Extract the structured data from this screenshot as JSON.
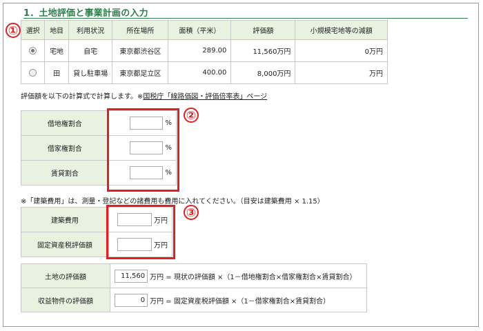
{
  "section_title": "1．土地評価と事業計画の入力",
  "markers": [
    "①",
    "②",
    "③"
  ],
  "land_table": {
    "headers": [
      "選択",
      "地目",
      "利用状況",
      "所在場所",
      "面積（平米）",
      "評価額",
      "小規模宅地等の減額"
    ],
    "rows": [
      {
        "selected": true,
        "type": "宅地",
        "usage": "自宅",
        "location": "東京都渋谷区",
        "area": "289.00",
        "value": "11,560万円",
        "reduction": "0万円"
      },
      {
        "selected": false,
        "type": "田",
        "usage": "貸し駐車場",
        "location": "東京都足立区",
        "area": "400.00",
        "value": "8,000万円",
        "reduction": "万円"
      }
    ]
  },
  "note1": {
    "text": "評価額を以下の計算式で計算します。※",
    "link": "国税庁「線路価図・評価倍率表」ページ"
  },
  "ratios": [
    {
      "label": "借地権割合",
      "value": "",
      "unit": "%"
    },
    {
      "label": "借家権割合",
      "value": "",
      "unit": "%"
    },
    {
      "label": "賃貸割合",
      "value": "",
      "unit": "%"
    }
  ],
  "note2": "※「建築費用」は、測量・登記などの諸費用も費用に入れてください。（目安は建築費用 × 1.15）",
  "costs": [
    {
      "label": "建築費用",
      "value": "",
      "unit": "万円"
    },
    {
      "label": "固定資産税評価額",
      "value": "",
      "unit": "万円"
    }
  ],
  "results": [
    {
      "label": "土地の評価額",
      "value": "11,560",
      "formula": "万円 = 現状の評価額 ×（1－借地権割合×借家権割合×賃貸割合）"
    },
    {
      "label": "収益物件の評価額",
      "value": "0",
      "formula": "万円 = 固定資産税評価額 ×（1－借家権割合×賃貸割合）"
    }
  ]
}
